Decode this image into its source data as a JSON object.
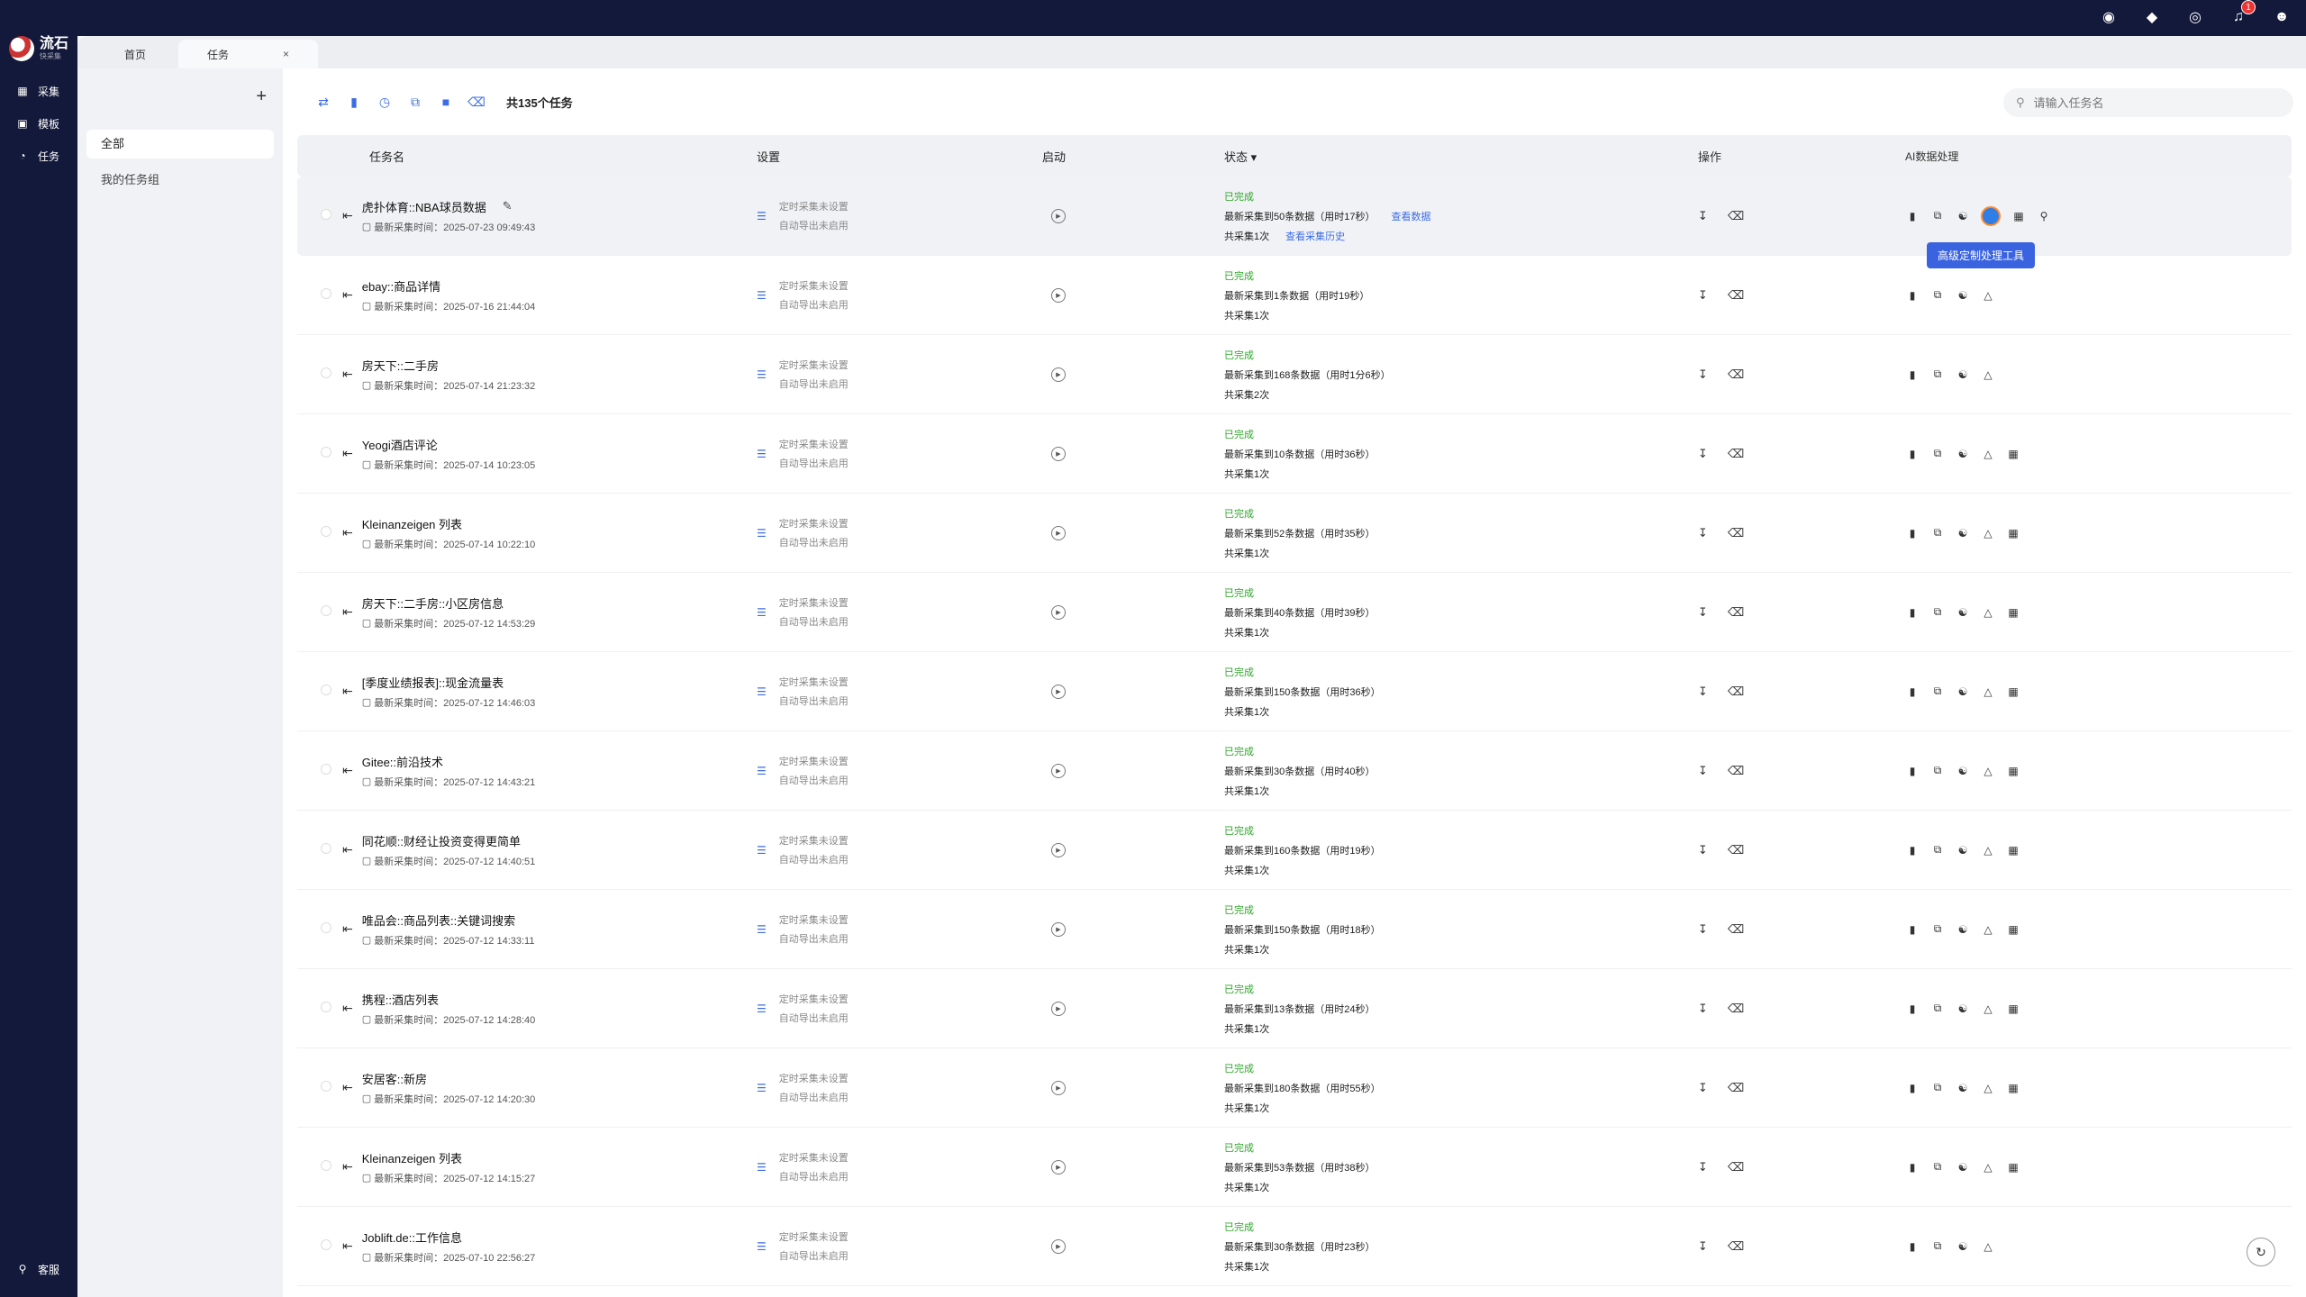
{
  "app": {
    "logo_text": "流石",
    "logo_sub": "快采集"
  },
  "rail": [
    {
      "label": "采集",
      "icon": "chart-icon"
    },
    {
      "label": "模板",
      "icon": "template-icon"
    },
    {
      "label": "任务",
      "icon": "task-icon"
    }
  ],
  "rail_bottom": {
    "label": "客服",
    "icon": "support-icon"
  },
  "top_icons": {
    "notification_count": "1"
  },
  "tabs": [
    {
      "label": "首页"
    },
    {
      "label": "任务",
      "close": "×"
    }
  ],
  "groups": {
    "add": "+",
    "items": [
      {
        "label": "全部"
      },
      {
        "label": "我的任务组"
      }
    ]
  },
  "toolbar": {
    "count_text": "共135个任务"
  },
  "search": {
    "placeholder": "请输入任务名"
  },
  "table": {
    "headers": {
      "name": "任务名",
      "settings": "设置",
      "start": "启动",
      "status": "状态",
      "ops": "操作",
      "ai": "AI数据处理"
    },
    "settings_line1": "定时采集未设置",
    "settings_line2": "自动导出未启用",
    "status_done": "已完成",
    "view_data": "查看数据",
    "view_history": "查看采集历史",
    "tooltip": "高级定制处理工具",
    "rows": [
      {
        "name": "虎扑体育::NBA球员数据",
        "time": "最新采集时间：2025-07-23 09:49:43",
        "line2": "最新采集到50条数据（用时17秒）",
        "line3": "共采集1次"
      },
      {
        "name": "ebay::商品详情",
        "time": "最新采集时间：2025-07-16 21:44:04",
        "line2": "最新采集到1条数据（用时19秒）",
        "line3": "共采集1次"
      },
      {
        "name": "房天下::二手房",
        "time": "最新采集时间：2025-07-14 21:23:32",
        "line2": "最新采集到168条数据（用时1分6秒）",
        "line3": "共采集2次"
      },
      {
        "name": "Yeogi酒店评论",
        "time": "最新采集时间：2025-07-14 10:23:05",
        "line2": "最新采集到10条数据（用时36秒）",
        "line3": "共采集1次"
      },
      {
        "name": "Kleinanzeigen 列表",
        "time": "最新采集时间：2025-07-14 10:22:10",
        "line2": "最新采集到52条数据（用时35秒）",
        "line3": "共采集1次"
      },
      {
        "name": "房天下::二手房::小区房信息",
        "time": "最新采集时间：2025-07-12 14:53:29",
        "line2": "最新采集到40条数据（用时39秒）",
        "line3": "共采集1次"
      },
      {
        "name": "[季度业绩报表]::现金流量表",
        "time": "最新采集时间：2025-07-12 14:46:03",
        "line2": "最新采集到150条数据（用时36秒）",
        "line3": "共采集1次"
      },
      {
        "name": "Gitee::前沿技术",
        "time": "最新采集时间：2025-07-12 14:43:21",
        "line2": "最新采集到30条数据（用时40秒）",
        "line3": "共采集1次"
      },
      {
        "name": "同花顺::财经让投资变得更简单",
        "time": "最新采集时间：2025-07-12 14:40:51",
        "line2": "最新采集到160条数据（用时19秒）",
        "line3": "共采集1次"
      },
      {
        "name": "唯品会::商品列表::关键词搜索",
        "time": "最新采集时间：2025-07-12 14:33:11",
        "line2": "最新采集到150条数据（用时18秒）",
        "line3": "共采集1次"
      },
      {
        "name": "携程::酒店列表",
        "time": "最新采集时间：2025-07-12 14:28:40",
        "line2": "最新采集到13条数据（用时24秒）",
        "line3": "共采集1次"
      },
      {
        "name": "安居客::新房",
        "time": "最新采集时间：2025-07-12 14:20:30",
        "line2": "最新采集到180条数据（用时55秒）",
        "line3": "共采集1次"
      },
      {
        "name": "Kleinanzeigen 列表",
        "time": "最新采集时间：2025-07-12 14:15:27",
        "line2": "最新采集到53条数据（用时38秒）",
        "line3": "共采集1次"
      },
      {
        "name": "Joblift.de::工作信息",
        "time": "最新采集时间：2025-07-10 22:56:27",
        "line2": "最新采集到30条数据（用时23秒）",
        "line3": "共采集1次"
      }
    ]
  }
}
